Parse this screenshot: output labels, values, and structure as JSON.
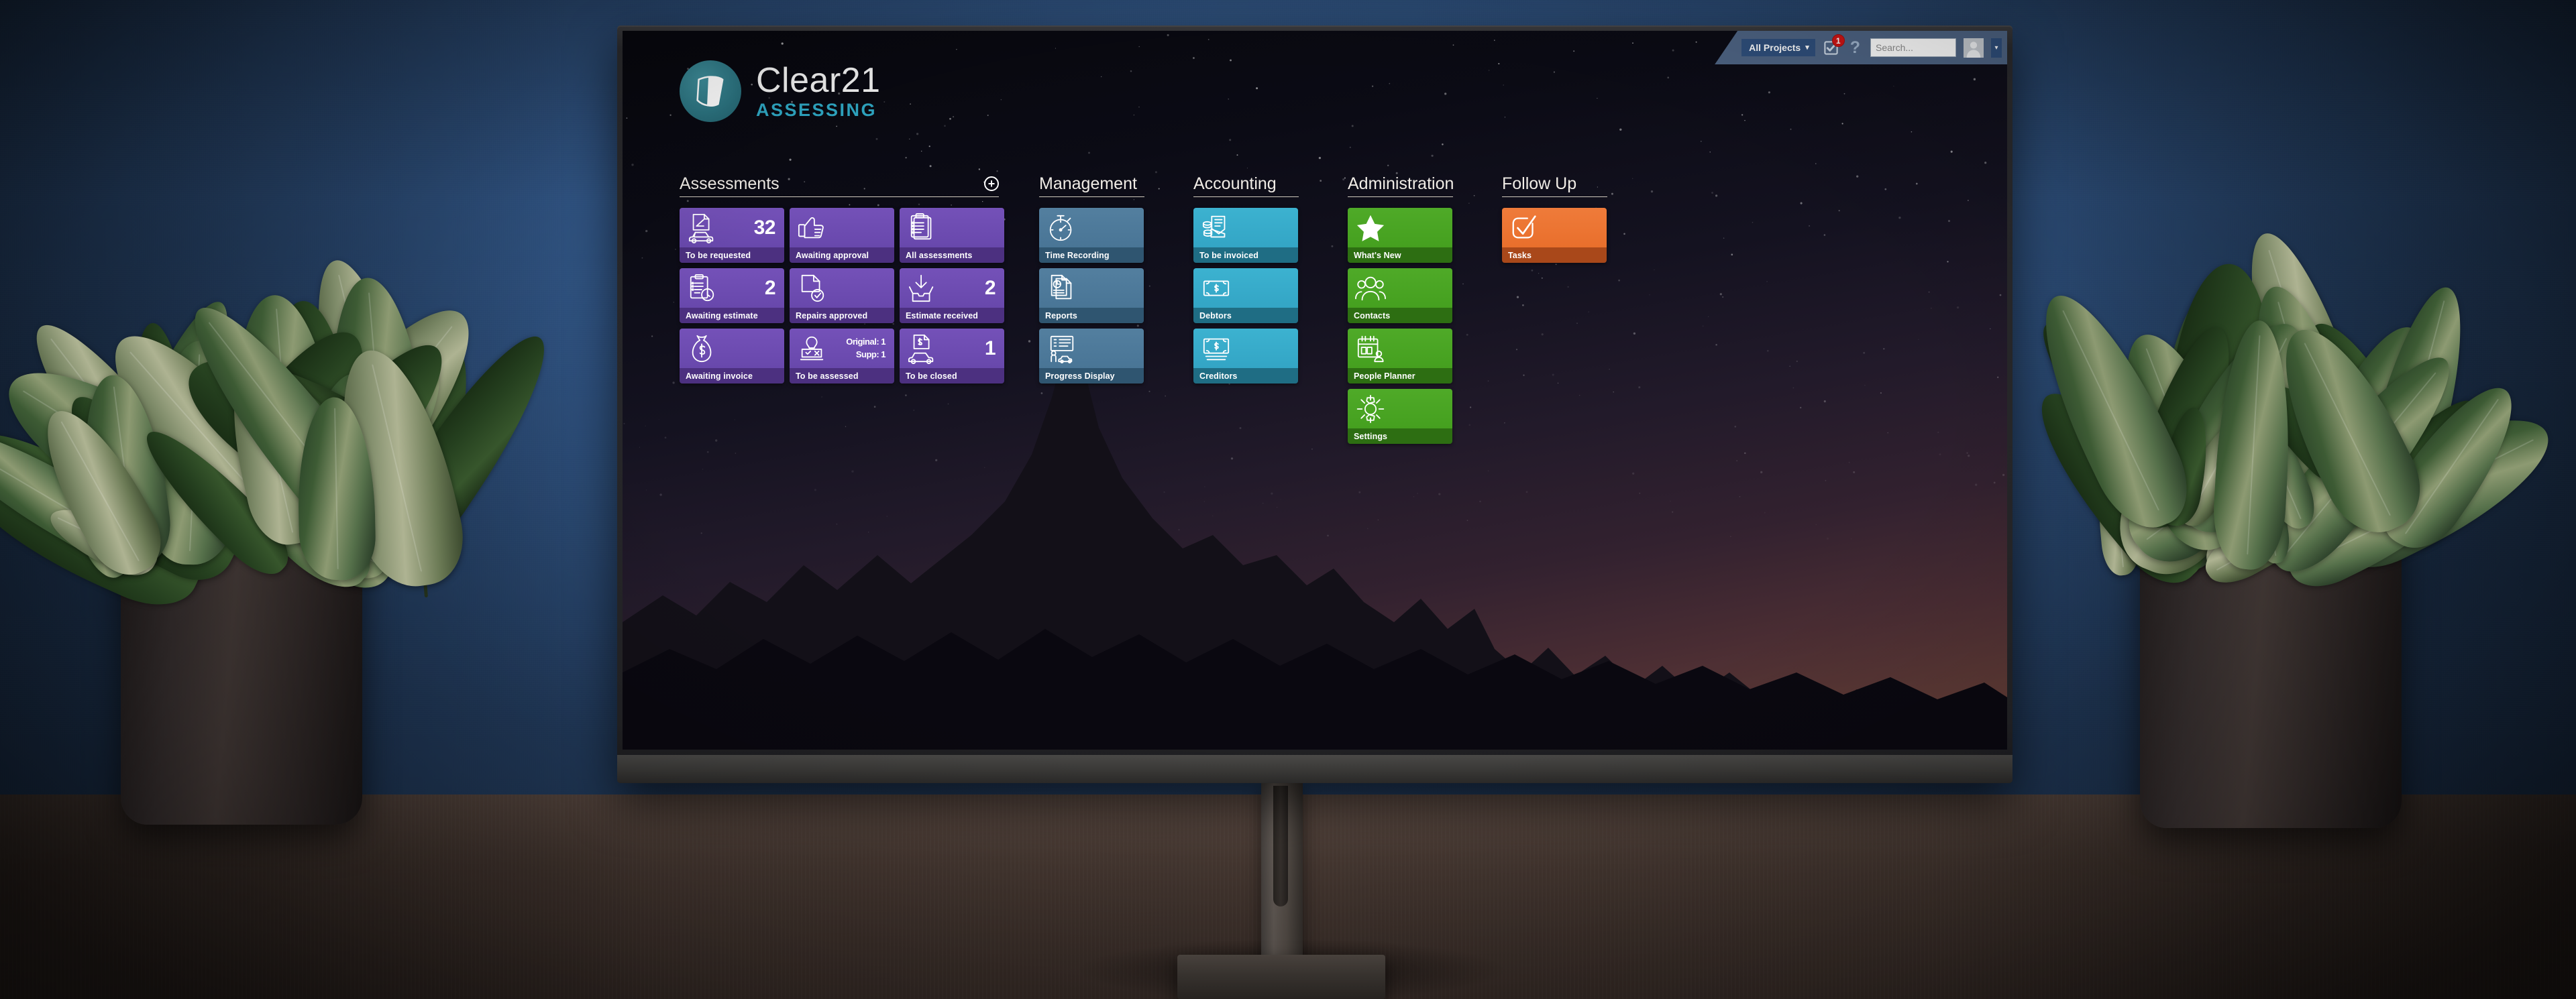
{
  "brand": {
    "name": "Clear21",
    "subtitle": "ASSESSING",
    "logo_icon": "clear21-logo-icon",
    "mark_color": "#2d7683",
    "accent_color": "#2fa8c4"
  },
  "toolbar": {
    "projects_label": "All Projects",
    "projects_chevron": "▾",
    "tasks_icon": "checkbox-check-icon",
    "tasks_badge": "1",
    "help_label": "?",
    "search_placeholder": "Search...",
    "search_value": "",
    "avatar_icon": "user-avatar-icon",
    "avatar_chevron": "▾",
    "badge_color": "#d11414",
    "bar_color": "#4e6484"
  },
  "columns": [
    {
      "title": "Assessments",
      "theme": "t-purple",
      "has_add": true,
      "add_label": "+",
      "tiles": [
        {
          "label": "To be requested",
          "count": "32",
          "icon": "car-document-icon"
        },
        {
          "label": "Awaiting approval",
          "count": "",
          "icon": "thumbs-up-icon"
        },
        {
          "label": "All assessments",
          "count": "",
          "icon": "clipboard-stack-icon"
        },
        {
          "label": "Awaiting estimate",
          "count": "2",
          "icon": "clipboard-clock-icon"
        },
        {
          "label": "Repairs approved",
          "count": "",
          "icon": "document-check-icon"
        },
        {
          "label": "Estimate received",
          "count": "2",
          "icon": "inbox-download-icon"
        },
        {
          "label": "Awaiting invoice",
          "count": "",
          "icon": "money-bag-icon"
        },
        {
          "label": "To be assessed",
          "count": "",
          "icon": "assessor-stamp-icon",
          "count_lines": [
            "Original: 1",
            "Supp: 1"
          ]
        },
        {
          "label": "To be closed",
          "count": "1",
          "icon": "invoice-car-icon"
        }
      ]
    },
    {
      "title": "Management",
      "theme": "t-steel",
      "has_add": false,
      "tiles": [
        {
          "label": "Time Recording",
          "count": "",
          "icon": "stopwatch-icon"
        },
        {
          "label": "Reports",
          "count": "",
          "icon": "report-chart-icon"
        },
        {
          "label": "Progress Display",
          "count": "",
          "icon": "progress-board-icon"
        }
      ]
    },
    {
      "title": "Accounting",
      "theme": "t-cyan",
      "has_add": false,
      "tiles": [
        {
          "label": "To be invoiced",
          "count": "",
          "icon": "invoice-coins-icon"
        },
        {
          "label": "Debtors",
          "count": "",
          "icon": "banknote-icon"
        },
        {
          "label": "Creditors",
          "count": "",
          "icon": "banknote-stack-icon"
        }
      ]
    },
    {
      "title": "Administration",
      "theme": "t-green",
      "has_add": false,
      "tiles": [
        {
          "label": "What's New",
          "count": "",
          "icon": "star-icon"
        },
        {
          "label": "Contacts",
          "count": "",
          "icon": "people-group-icon"
        },
        {
          "label": "People Planner",
          "count": "",
          "icon": "calendar-person-icon"
        },
        {
          "label": "Settings",
          "count": "",
          "icon": "gear-icon"
        }
      ]
    },
    {
      "title": "Follow Up",
      "theme": "t-orange",
      "has_add": false,
      "tiles": [
        {
          "label": "Tasks",
          "count": "",
          "icon": "check-square-icon"
        }
      ]
    }
  ],
  "theme": {
    "purple": "#6848ac",
    "steel": "#497596",
    "cyan": "#33a5c5",
    "green": "#45a01f",
    "orange": "#e96f2c",
    "wall": "#355d92",
    "desk": "#4a3b34",
    "screen_bg": "#0a0a10"
  }
}
